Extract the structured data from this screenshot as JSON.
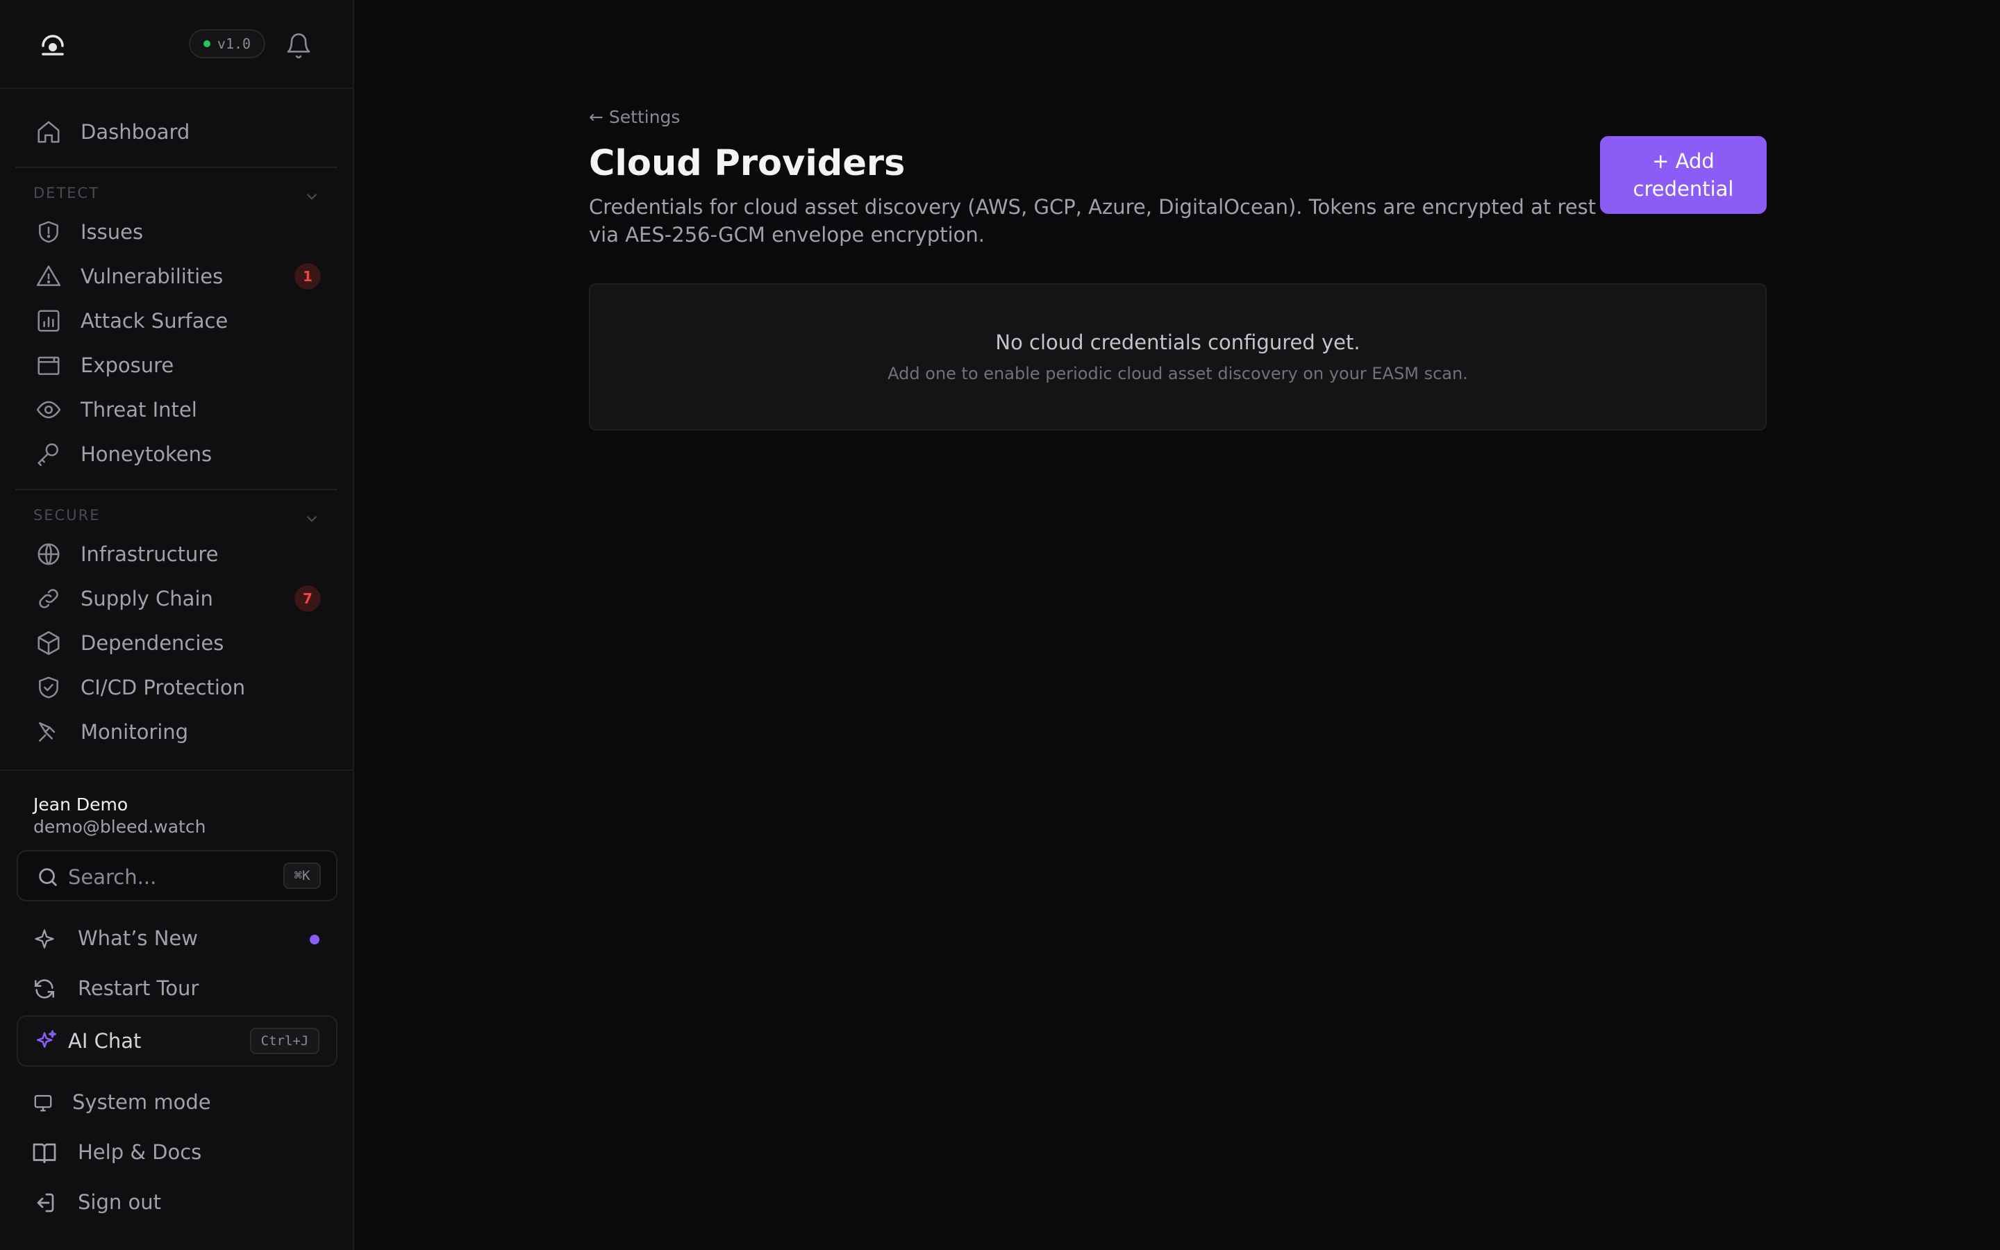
{
  "header": {
    "version": "v1.0"
  },
  "nav": {
    "dashboard": "Dashboard",
    "detect_label": "DETECT",
    "detect_items": [
      {
        "label": "Issues",
        "icon": "shield-alert-icon"
      },
      {
        "label": "Vulnerabilities",
        "icon": "warning-triangle-icon",
        "badge": "1"
      },
      {
        "label": "Attack Surface",
        "icon": "bar-chart-icon"
      },
      {
        "label": "Exposure",
        "icon": "browser-window-icon"
      },
      {
        "label": "Threat Intel",
        "icon": "eye-icon"
      },
      {
        "label": "Honeytokens",
        "icon": "key-icon"
      }
    ],
    "secure_label": "SECURE",
    "secure_items": [
      {
        "label": "Infrastructure",
        "icon": "globe-icon"
      },
      {
        "label": "Supply Chain",
        "icon": "link-icon",
        "badge": "7"
      },
      {
        "label": "Dependencies",
        "icon": "package-icon"
      },
      {
        "label": "CI/CD Protection",
        "icon": "shield-check-icon"
      },
      {
        "label": "Monitoring",
        "icon": "radar-icon"
      }
    ]
  },
  "user": {
    "name": "Jean Demo",
    "email": "demo@bleed.watch"
  },
  "search": {
    "placeholder": "Search...",
    "shortcut": "⌘K"
  },
  "bottom_nav": {
    "whats_new": "What’s New",
    "restart_tour": "Restart Tour",
    "ai_chat": "AI Chat",
    "ai_chat_shortcut": "Ctrl+J",
    "system_mode": "System mode",
    "help_docs": "Help & Docs",
    "sign_out": "Sign out"
  },
  "main": {
    "back_link": "← Settings",
    "title": "Cloud Providers",
    "description": "Credentials for cloud asset discovery (AWS, GCP, Azure, DigitalOcean). Tokens are encrypted at rest via AES-256-GCM envelope encryption.",
    "add_button": "+ Add credential",
    "empty_title": "No cloud credentials configured yet.",
    "empty_subtitle": "Add one to enable periodic cloud asset discovery on your EASM scan."
  },
  "colors": {
    "accent": "#8b5cf6",
    "status_online": "#22c55e",
    "badge_text": "#ef4444",
    "background": "#0a0a0c"
  }
}
